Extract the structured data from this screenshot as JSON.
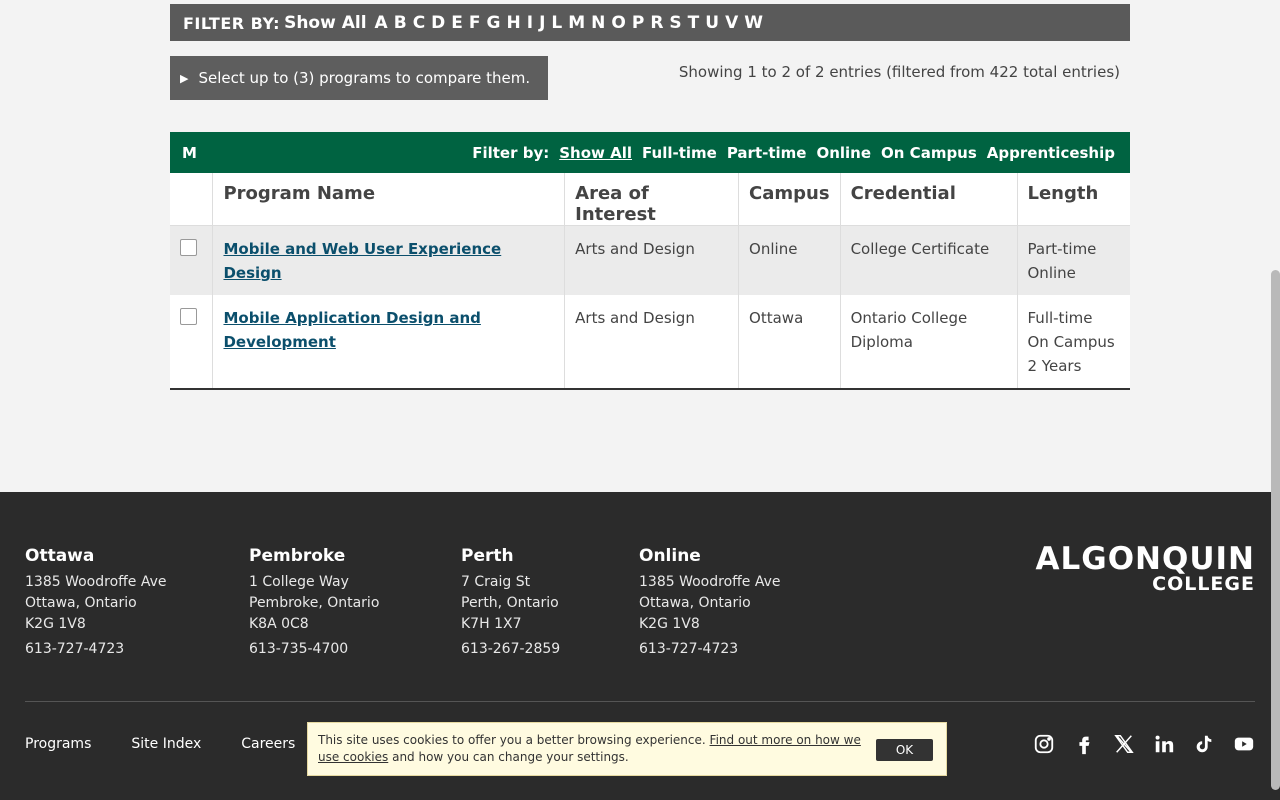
{
  "filter_bar": {
    "label": "FILTER BY:",
    "show_all": "Show All",
    "letters": [
      "A",
      "B",
      "C",
      "D",
      "E",
      "F",
      "G",
      "H",
      "I",
      "J",
      "L",
      "M",
      "N",
      "O",
      "P",
      "R",
      "S",
      "T",
      "U",
      "V",
      "W"
    ]
  },
  "compare": {
    "label": "Select up to (3) programs to compare them."
  },
  "entries_info": "Showing 1 to 2 of 2 entries (filtered from 422 total entries)",
  "table": {
    "letter": "M",
    "filter_label": "Filter by:",
    "filters": [
      "Show All",
      "Full-time",
      "Part-time",
      "Online",
      "On Campus",
      "Apprenticeship"
    ],
    "columns": [
      "",
      "Program Name",
      "Area of Interest",
      "Campus",
      "Credential",
      "Length"
    ],
    "rows": [
      {
        "program": "Mobile and Web User Experience Design",
        "area": "Arts and Design",
        "campus": "Online",
        "credential": "College Certificate",
        "length_line1": "Part-time",
        "length_line2": "Online",
        "length_line3": ""
      },
      {
        "program": "Mobile Application Design and Development",
        "area": "Arts and Design",
        "campus": "Ottawa",
        "credential": "Ontario College Diploma",
        "length_line1": "Full-time",
        "length_line2": "On Campus",
        "length_line3": "2 Years"
      }
    ]
  },
  "footer": {
    "campuses": [
      {
        "name": "Ottawa",
        "line1": "1385 Woodroffe Ave",
        "line2": "Ottawa, Ontario",
        "line3": "K2G 1V8",
        "phone": "613-727-4723"
      },
      {
        "name": "Pembroke",
        "line1": "1 College Way",
        "line2": "Pembroke, Ontario",
        "line3": "K8A 0C8",
        "phone": "613-735-4700"
      },
      {
        "name": "Perth",
        "line1": "7 Craig St",
        "line2": "Perth, Ontario",
        "line3": "K7H 1X7",
        "phone": "613-267-2859"
      },
      {
        "name": "Online",
        "line1": "1385 Woodroffe Ave",
        "line2": "Ottawa, Ontario",
        "line3": "K2G 1V8",
        "phone": "613-727-4723"
      }
    ],
    "logo_line1": "ALGONQUIN",
    "logo_line2": "COLLEGE",
    "links": [
      "Programs",
      "Site Index",
      "Careers"
    ],
    "social": [
      "instagram-icon",
      "facebook-icon",
      "x-icon",
      "linkedin-icon",
      "tiktok-icon",
      "youtube-icon"
    ]
  },
  "cookie": {
    "text1": "This site uses cookies to offer you a better browsing experience.",
    "link": "Find out more on how we use cookies",
    "text2": "and how you can change your settings.",
    "ok": "OK"
  },
  "colors": {
    "table_header": "#006341",
    "filter_bar": "#5a5a5a",
    "footer": "#2b2b2b",
    "link": "#0b4f6c"
  }
}
